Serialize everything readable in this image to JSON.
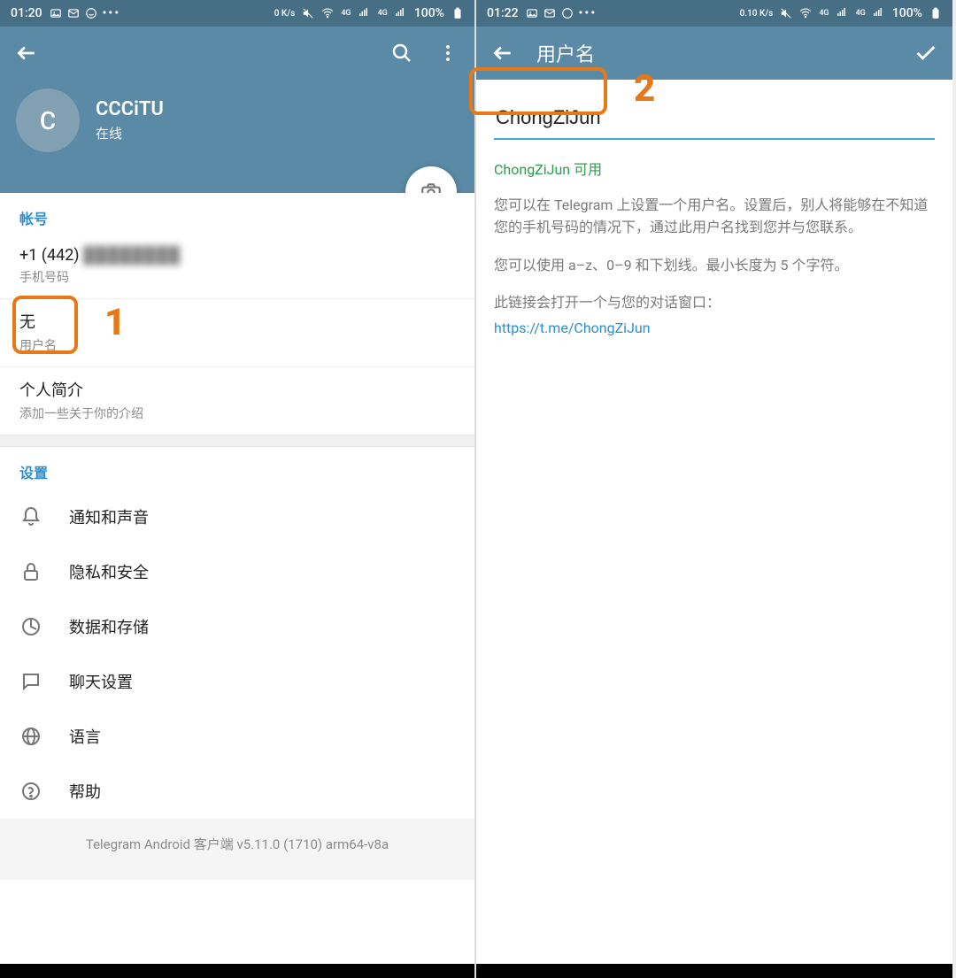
{
  "left": {
    "statusbar": {
      "time": "01:20",
      "speed": "0 K/s",
      "net1": "4G",
      "net2": "4G",
      "battery": "100%"
    },
    "profile": {
      "avatar_letter": "C",
      "name": "CCCiTU",
      "status": "在线"
    },
    "account": {
      "header": "帐号",
      "phone_value": "+1 (442) ",
      "phone_hidden": "████████",
      "phone_label": "手机号码",
      "username_value": "无",
      "username_label": "用户名",
      "bio_value": "个人简介",
      "bio_label": "添加一些关于你的介绍"
    },
    "settings": {
      "header": "设置",
      "notifications": "通知和声音",
      "privacy": "隐私和安全",
      "data": "数据和存储",
      "chat": "聊天设置",
      "language": "语言",
      "help": "帮助"
    },
    "footer": "Telegram Android 客户端 v5.11.0 (1710) arm64-v8a",
    "annotation": "1"
  },
  "right": {
    "statusbar": {
      "time": "01:22",
      "speed": "0.10 K/s",
      "net1": "4G",
      "net2": "4G",
      "battery": "100%"
    },
    "toolbar": {
      "title": "用户名"
    },
    "input_value": "ChongZiJun",
    "available": "ChongZiJun 可用",
    "para1": "您可以在 Telegram 上设置一个用户名。设置后，别人将能够在不知道您的手机号码的情况下，通过此用户名找到您并与您联系。",
    "para2": "您可以使用 a–z、0–9 和下划线。最小长度为 5 个字符。",
    "para3": "此链接会打开一个与您的对话窗口：",
    "link": "https://t.me/ChongZiJun",
    "annotation": "2"
  }
}
